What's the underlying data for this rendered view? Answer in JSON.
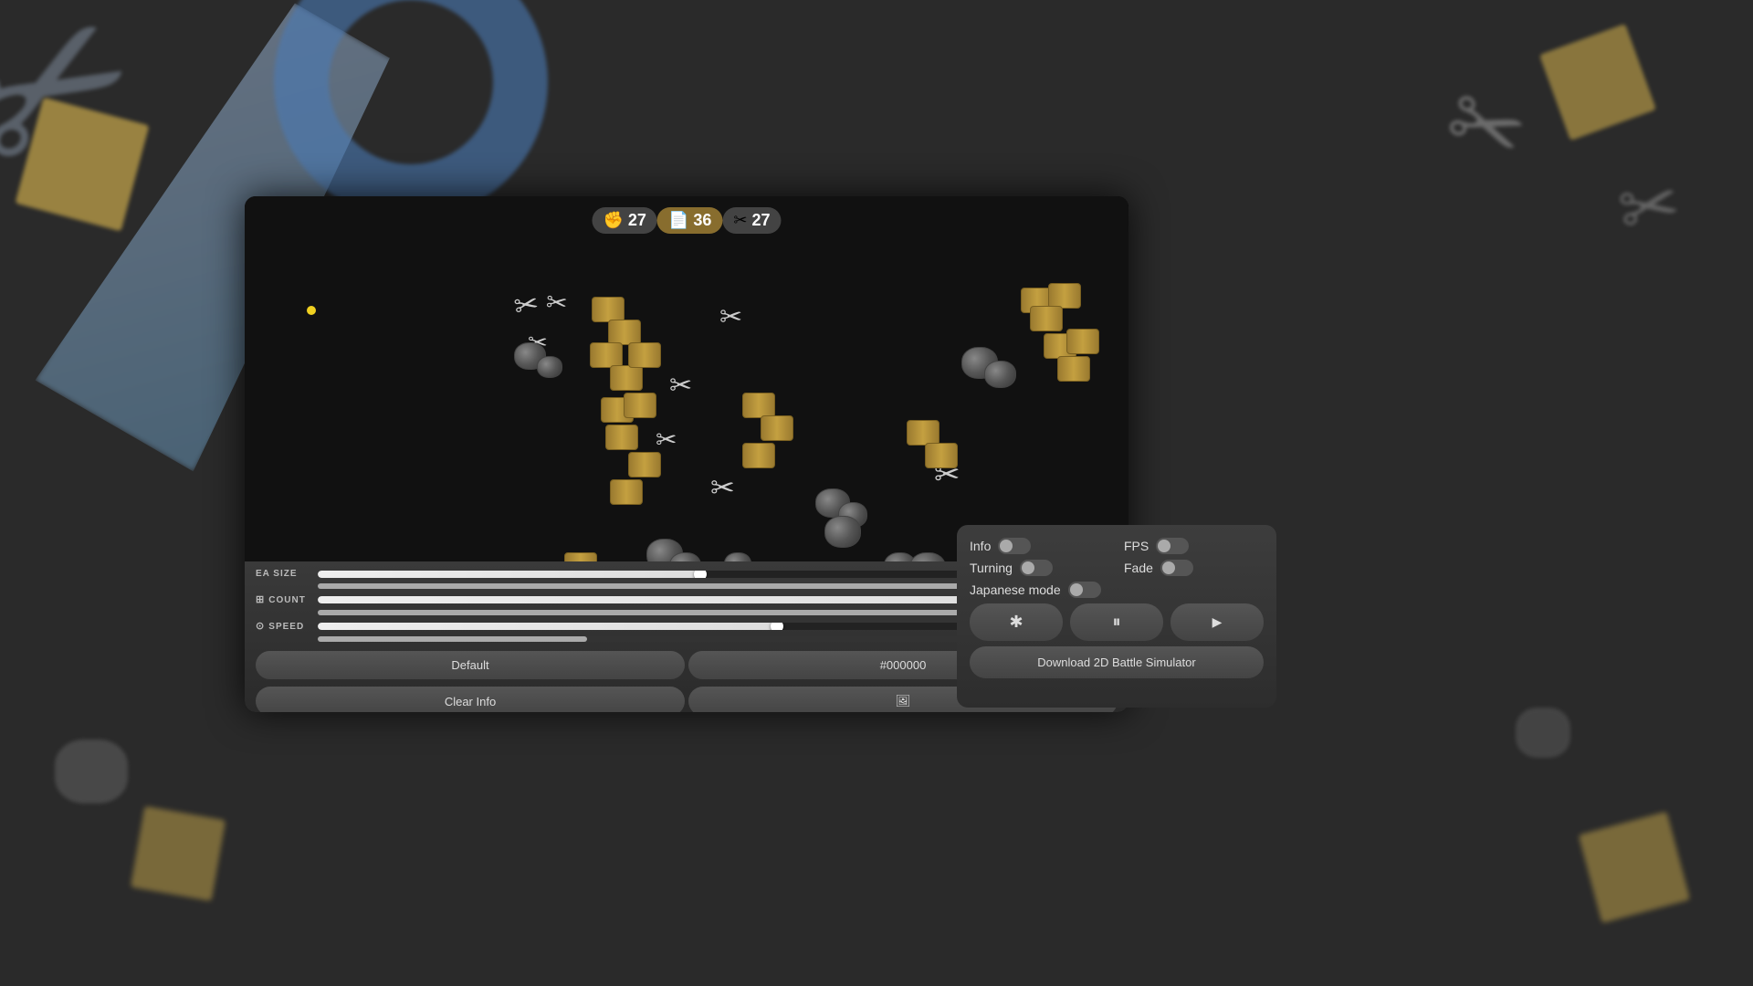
{
  "app": {
    "title": "2D Battle Simulator"
  },
  "background": {
    "scissorsLarge": "✂",
    "scissorsTR": "✂",
    "scissorsTR2": "✂"
  },
  "score": {
    "hand_icon": "✊",
    "hand_count": "27",
    "paper_icon": "📄",
    "paper_count": "36",
    "scissors_icon": "✂",
    "scissors_count": "27"
  },
  "sliders": {
    "ea_size": {
      "label": "EA SIZE",
      "value": "7",
      "min": "1",
      "max": "13",
      "fill_pct": 50
    },
    "count": {
      "label": "COUNT",
      "value": "30x3",
      "min": "1",
      "max": "30",
      "fill_pct": 100
    },
    "speed": {
      "label": "SPEED",
      "value": "1",
      "min": "0.1",
      "max": "2",
      "fill_pct": 60
    }
  },
  "buttons": {
    "default_label": "Default",
    "color_label": "#000000",
    "clear_info_label": "Clear Info",
    "screenshot_icon": "🖼"
  },
  "right_panel": {
    "info_label": "Info",
    "fps_label": "FPS",
    "turning_label": "Turning",
    "fade_label": "Fade",
    "japanese_mode_label": "Japanese mode",
    "star_icon": "✱",
    "pause_icon": "⏸",
    "download_label": "Download 2D Battle Simulator"
  }
}
